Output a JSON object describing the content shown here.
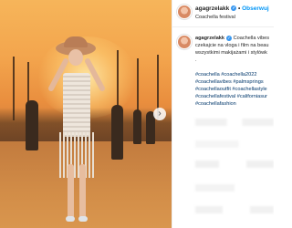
{
  "header": {
    "username": "agagrzelakk",
    "follow_label": "Obserwuj",
    "separator": "•",
    "location": "Coachella festival"
  },
  "caption": {
    "username": "agagrzelakk",
    "line1": "Coachella vibes",
    "line2": "czekajcie na vloga i film na beau",
    "line3": "wszystkimi makijażami i stylówk",
    "line4": ".",
    "hashtags": [
      "#coachella #coachella2022",
      "#coachellavibes #palmsprings",
      "#coachellaoutfit #coachellastyle",
      "#coachellafestival #californiasur",
      "#coachellafashion"
    ]
  },
  "icons": {
    "verified": "verified-badge-icon",
    "next": "chevron-right-icon"
  },
  "colors": {
    "link_blue": "#0095f6",
    "hashtag_blue": "#00376b",
    "verified_blue": "#3897f0"
  }
}
